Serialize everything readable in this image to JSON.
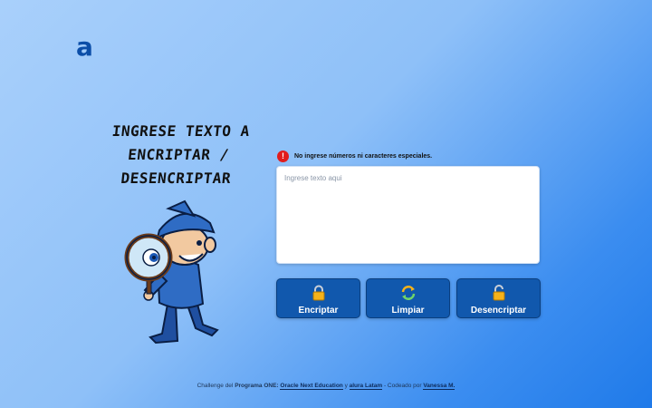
{
  "logo": {
    "glyph": "a"
  },
  "title": {
    "line1": "INGRESE TEXTO A",
    "line2": "ENCRIPTAR /",
    "line3": "DESENCRIPTAR"
  },
  "warning": {
    "icon": "!",
    "text": "No ingrese números ni caracteres especiales."
  },
  "input": {
    "placeholder": "Ingrese texto aqui",
    "value": ""
  },
  "buttons": {
    "encrypt": {
      "label": "Encriptar",
      "icon": "lock-icon"
    },
    "clear": {
      "label": "Limpiar",
      "icon": "refresh-icon"
    },
    "decrypt": {
      "label": "Desencriptar",
      "icon": "unlock-icon"
    }
  },
  "footer": {
    "prefix": "Challenge del",
    "program": "Programa ONE:",
    "oracle": "Oracle Next Education",
    "and": "y",
    "alura": "alura Latam",
    "coded": "- Codeado por",
    "author": "Vanessa M."
  },
  "colors": {
    "button_bg": "#1158ad",
    "warning": "#e11d1d",
    "logo": "#0b4ea8"
  }
}
